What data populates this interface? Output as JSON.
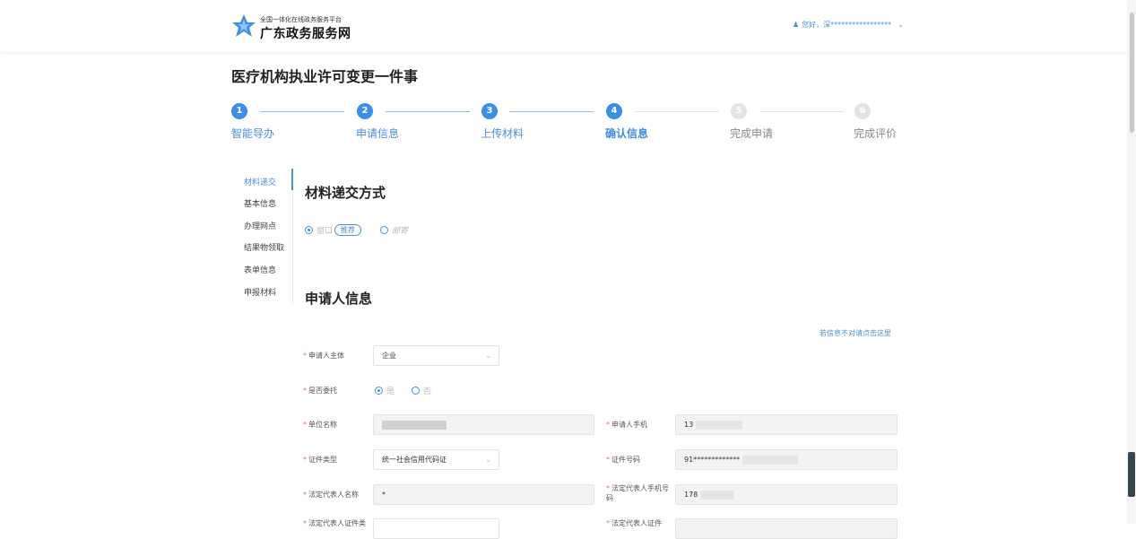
{
  "header": {
    "logo_sub": "全国一体化在线政务服务平台",
    "logo_main": "广东政务服务网",
    "user_greeting": "您好，深*****************",
    "logo_color": "#3d8ee6"
  },
  "page": {
    "title": "医疗机构执业许可变更一件事"
  },
  "steps": [
    {
      "num": "1",
      "label": "智能导办",
      "state": "done"
    },
    {
      "num": "2",
      "label": "申请信息",
      "state": "done"
    },
    {
      "num": "3",
      "label": "上传材料",
      "state": "done"
    },
    {
      "num": "4",
      "label": "确认信息",
      "state": "current"
    },
    {
      "num": "5",
      "label": "完成申请",
      "state": "todo"
    },
    {
      "num": "6",
      "label": "完成评价",
      "state": "todo"
    }
  ],
  "anchor_nav": [
    "材料递交",
    "基本信息",
    "办理网点",
    "结果物领取",
    "表单信息",
    "申报材料"
  ],
  "delivery": {
    "title": "材料递交方式",
    "option1": "窗口",
    "option1_badge": "推荐",
    "option2": "邮寄"
  },
  "applicant": {
    "title": "申请人信息",
    "correction_link": "若信息不对请点击这里",
    "subject_label": "申请人主体",
    "subject_value": "企业",
    "entrust_label": "是否委托",
    "entrust_yes": "是",
    "entrust_no": "否",
    "org_name_label": "单位名称",
    "phone_label": "申请人手机",
    "phone_value": "13",
    "cert_type_label": "证件类型",
    "cert_type_value": "统一社会信用代码证",
    "cert_no_label": "证件号码",
    "cert_no_value": "91*************",
    "legal_name_label": "法定代表人名称",
    "legal_name_value": "*",
    "legal_phone_label": "法定代表人手机号码",
    "legal_phone_value": "178",
    "legal_cert_label": "法定代表人证件类",
    "legal_cert_label2": "法定代表人证件"
  },
  "colors": {
    "accent": "#3d8ee6",
    "required": "#f56c6c"
  }
}
